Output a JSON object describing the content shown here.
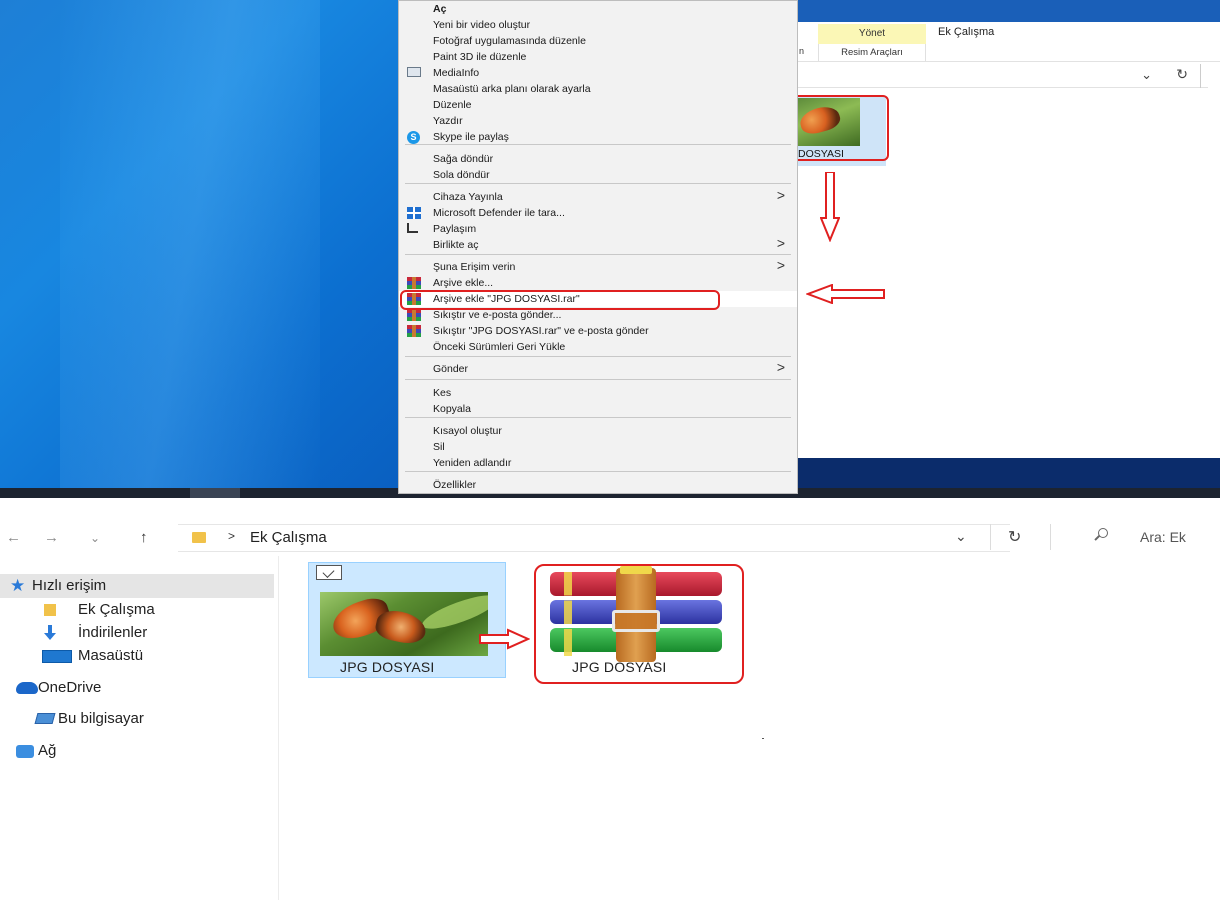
{
  "context_menu": {
    "items": [
      {
        "label": "Aç",
        "bold": true
      },
      {
        "label": "Yeni bir video oluştur"
      },
      {
        "label": "Fotoğraf uygulamasında düzenle"
      },
      {
        "label": "Paint 3D ile düzenle"
      },
      {
        "label": "MediaInfo",
        "icon": "mediainfo-icon"
      },
      {
        "label": "Masaüstü arka planı olarak ayarla"
      },
      {
        "label": "Düzenle"
      },
      {
        "label": "Yazdır"
      },
      {
        "label": "Skype ile paylaş",
        "icon": "skype-icon"
      },
      {
        "label": "Sağa döndür"
      },
      {
        "label": "Sola döndür"
      },
      {
        "label": "Cihaza Yayınla",
        "submenu": true
      },
      {
        "label": "Microsoft Defender ile tara...",
        "icon": "defender-icon"
      },
      {
        "label": "Paylaşım",
        "icon": "share-icon"
      },
      {
        "label": "Birlikte aç",
        "submenu": true
      },
      {
        "label": "Şuna Erişim verin",
        "submenu": true
      },
      {
        "label": "Arşive ekle...",
        "icon": "winrar-icon"
      },
      {
        "label": "Arşive ekle \"JPG DOSYASI.rar\"",
        "icon": "winrar-icon",
        "highlighted": true
      },
      {
        "label": "Sıkıştır ve e-posta gönder...",
        "icon": "winrar-icon"
      },
      {
        "label": "Sıkıştır \"JPG DOSYASI.rar\" ve e-posta gönder",
        "icon": "winrar-icon"
      },
      {
        "label": "Önceki Sürümleri Geri Yükle"
      },
      {
        "label": "Gönder",
        "submenu": true
      },
      {
        "label": "Kes"
      },
      {
        "label": "Kopyala"
      },
      {
        "label": "Kısayol oluştur"
      },
      {
        "label": "Sil"
      },
      {
        "label": "Yeniden adlandır"
      },
      {
        "label": "Özellikler"
      }
    ],
    "submenu_arrow": ">"
  },
  "top_explorer": {
    "ribbon_tab_manage": "Yönet",
    "ribbon_tab_picture_tools": "Resim Araçları",
    "ribbon_cut_tab": "n",
    "folder_title": "Ek Çalışma",
    "file_label": "DOSYASI",
    "chevron": "⌄",
    "refresh": "↻"
  },
  "explorer": {
    "nav": {
      "back": "←",
      "forward": "→",
      "recent": "⌄",
      "up": "↑"
    },
    "breadcrumb_sep": ">",
    "breadcrumb": "Ek Çalışma",
    "addr_chevron": "⌄",
    "refresh": "↻",
    "search_placeholder": "Ara: Ek",
    "sidebar": [
      {
        "label": "Hızlı erişim",
        "icon": "star-icon",
        "selected": true
      },
      {
        "label": "Ek Çalışma",
        "icon": "folder-icon"
      },
      {
        "label": "İndirilenler",
        "icon": "download-icon"
      },
      {
        "label": "Masaüstü",
        "icon": "desktop-icon"
      },
      {
        "label": "OneDrive",
        "icon": "onedrive-icon"
      },
      {
        "label": "Bu bilgisayar",
        "icon": "computer-icon"
      },
      {
        "label": "Ağ",
        "icon": "network-icon"
      }
    ],
    "files": [
      {
        "name": "JPG DOSYASI",
        "type": "image",
        "selected": true,
        "checked": true
      },
      {
        "name": "JPG DOSYASI",
        "type": "rar-archive"
      }
    ]
  },
  "annotation_color": "#e02020"
}
